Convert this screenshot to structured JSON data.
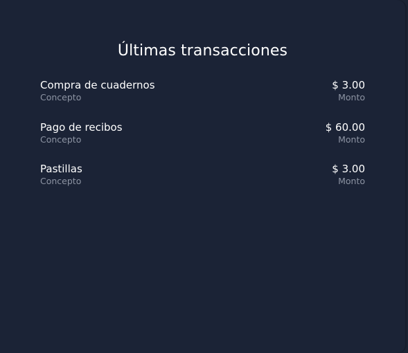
{
  "panel": {
    "title": "Últimas transacciones"
  },
  "transactions": [
    {
      "concept": "Compra de cuadernos",
      "concept_label": "Concepto",
      "amount": "$ 3.00",
      "amount_label": "Monto"
    },
    {
      "concept": "Pago de recibos",
      "concept_label": "Concepto",
      "amount": "$ 60.00",
      "amount_label": "Monto"
    },
    {
      "concept": "Pastillas",
      "concept_label": "Concepto",
      "amount": "$ 3.00",
      "amount_label": "Monto"
    }
  ],
  "colors": {
    "background": "#1b2336",
    "text_primary": "#ffffff",
    "text_secondary": "#8d94a3"
  }
}
